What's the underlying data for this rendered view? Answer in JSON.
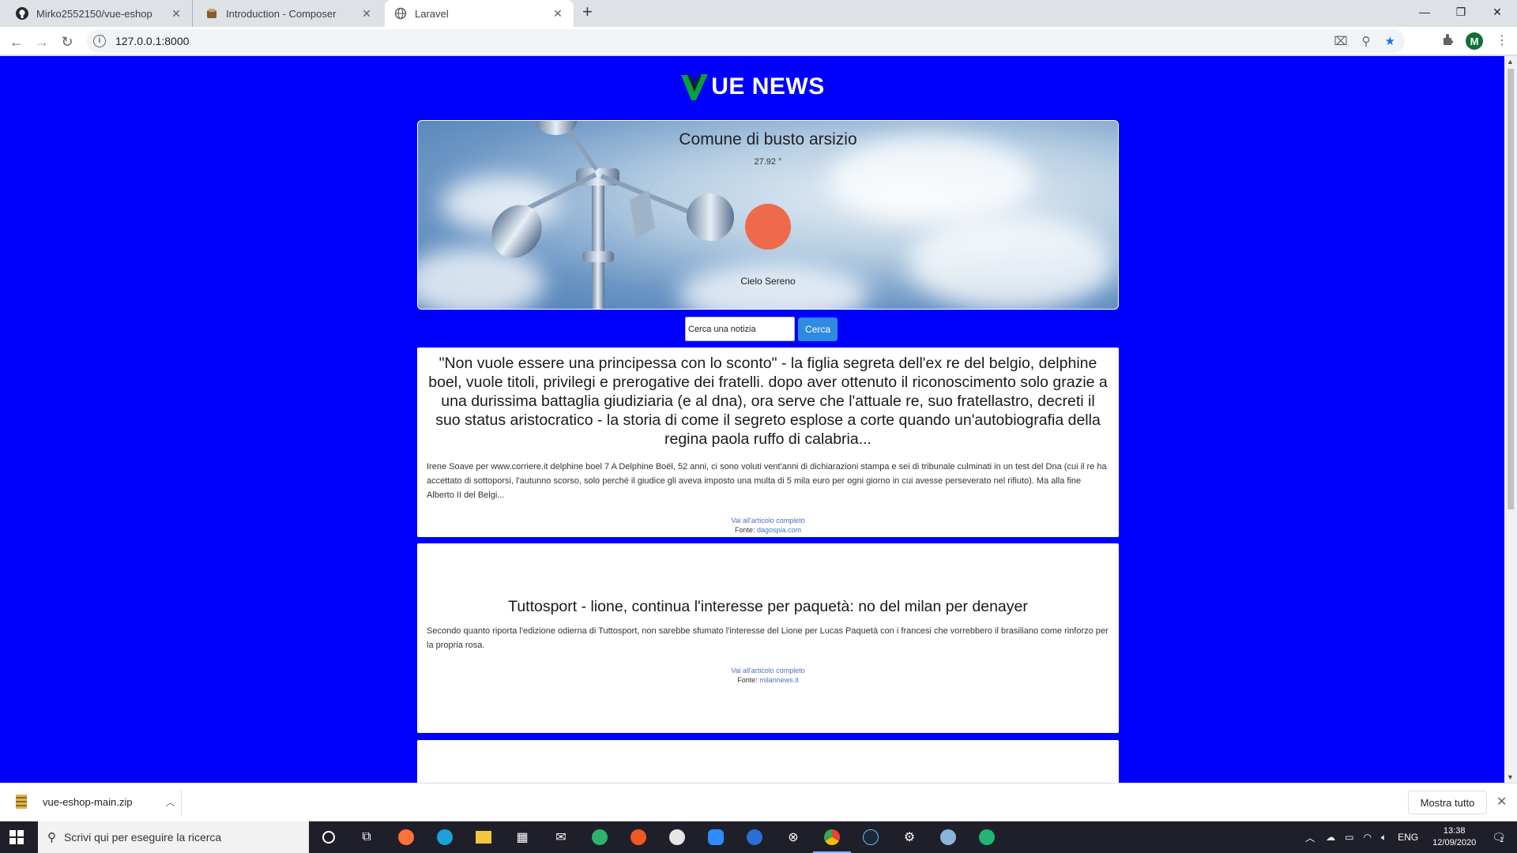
{
  "browser": {
    "tabs": [
      {
        "title": "Mirko2552150/vue-eshop",
        "icon": "github-icon",
        "active": false
      },
      {
        "title": "Introduction - Composer",
        "icon": "composer-icon",
        "active": false
      },
      {
        "title": "Laravel",
        "icon": "globe-icon",
        "active": true
      }
    ],
    "url": "127.0.0.1:8000",
    "profile_initial": "M"
  },
  "page": {
    "background": "#0000ff",
    "brand": {
      "name": "UE NEWS",
      "logo_color": "#0a9e3c"
    },
    "weather": {
      "city": "Comune di busto arsizio",
      "temperature": "27.92 °",
      "description": "Cielo Sereno",
      "sun_color": "#ef6a4a"
    },
    "search": {
      "placeholder": "Cerca una notizia",
      "button": "Cerca"
    },
    "articles": [
      {
        "title": "\"Non vuole essere una principessa con lo sconto\" - la figlia segreta dell'ex re del belgio, delphine boel, vuole titoli, privilegi e prerogative dei fratelli. dopo aver ottenuto il riconoscimento solo grazie a una durissima battaglia giudiziaria (e al dna), ora serve che l'attuale re, suo fratellastro, decreti il suo status aristocratico - la storia di come il segreto esplose a corte quando un'autobiografia della regina paola ruffo di calabria...",
        "body": "Irene Soave per www.corriere.it delphine boel 7   A Delphine Boël, 52 anni, ci sono voluti vent'anni di dichiarazioni stampa e sei di tribunale culminati in un test del Dna (cui il re ha accettato di sottoporsi, l'autunno scorso, solo perché il giudice gli aveva imposto una multa di 5 mila euro per ogni giorno in cui avesse perseverato nel rifiuto). Ma alla fine Alberto II del Belgi...",
        "link": "Vai all'articolo completo",
        "source_label": "Fonte:",
        "source": "dagospia.com"
      },
      {
        "title": "Tuttosport - lione, continua l'interesse per paquetà: no del milan per denayer",
        "body": "Secondo quanto riporta l'edizione odierna di Tuttosport, non sarebbe sfumato l'interesse del Lione per Lucas Paquetà con i francesi che vorrebbero il brasiliano come rinforzo per la propria rosa.",
        "link": "Vai all'articolo completo",
        "source_label": "Fonte:",
        "source": "milannews.it"
      }
    ]
  },
  "downloads": {
    "file": "vue-eshop-main.zip",
    "show_all": "Mostra tutto"
  },
  "taskbar": {
    "search_placeholder": "Scrivi qui per eseguire la ricerca",
    "language": "ENG",
    "time": "13:38",
    "date": "12/09/2020",
    "notifications": "1"
  }
}
